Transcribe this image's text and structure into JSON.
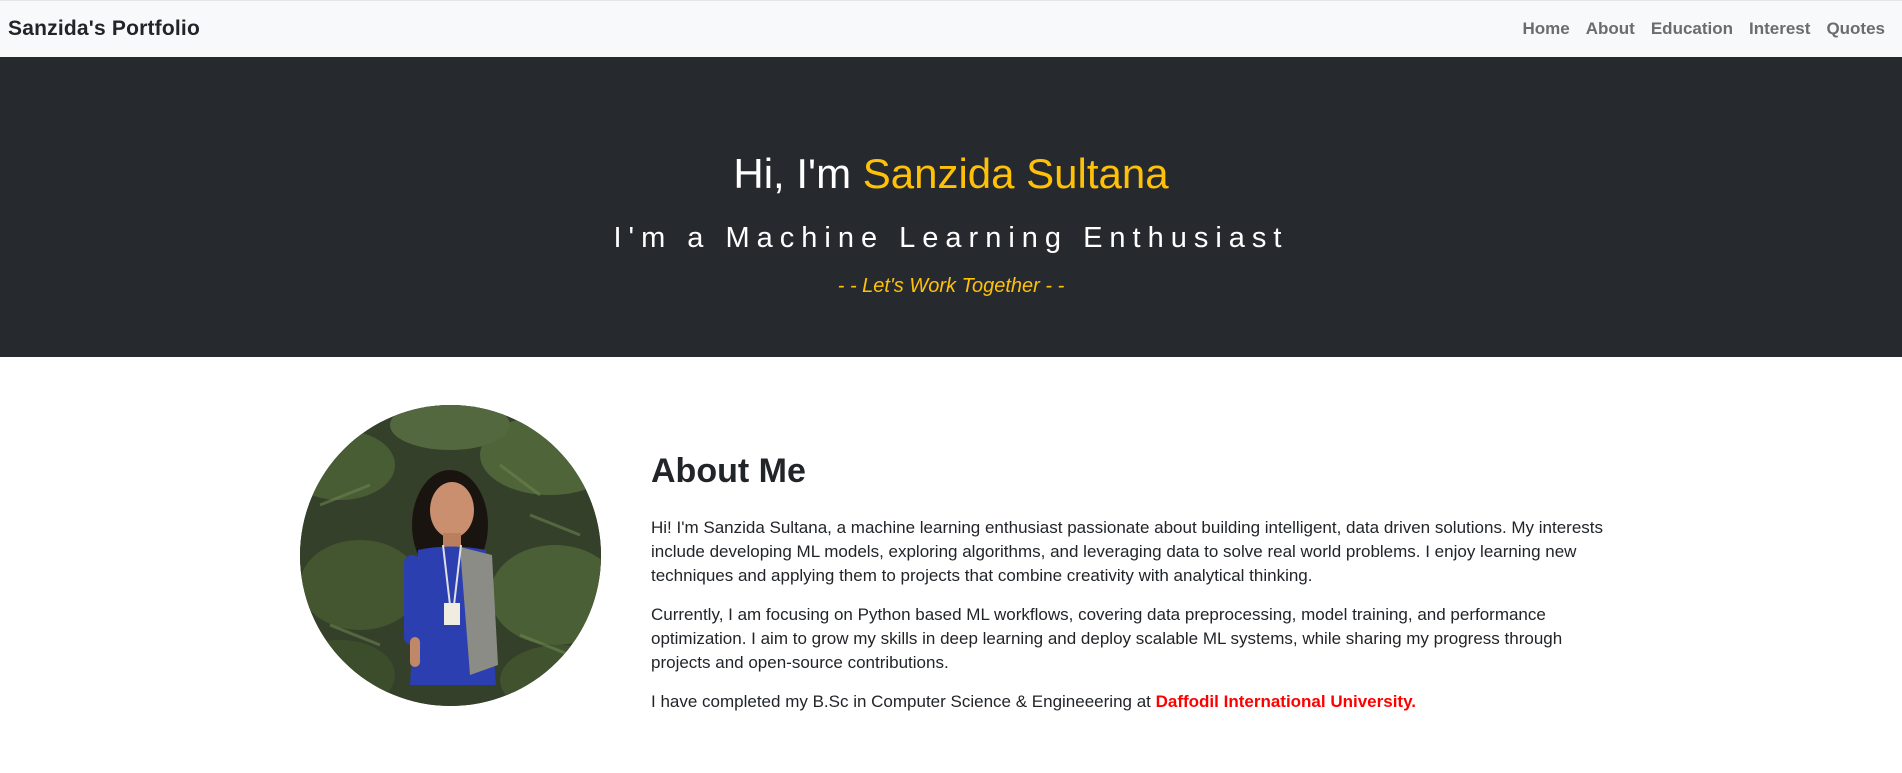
{
  "navbar": {
    "brand": "Sanzida's Portfolio",
    "links": [
      {
        "label": "Home"
      },
      {
        "label": "About"
      },
      {
        "label": "Education"
      },
      {
        "label": "Interest"
      },
      {
        "label": "Quotes"
      }
    ]
  },
  "hero": {
    "greeting": "Hi, I'm ",
    "name": "Sanzida Sultana",
    "subtitle": "I'm a Machine Learning Enthusiast",
    "cta": "- - Let's Work Together - -"
  },
  "about": {
    "heading": "About Me",
    "paragraph1": "Hi! I'm Sanzida Sultana, a machine learning enthusiast passionate about building intelligent, data driven solutions. My interests include developing ML models, exploring algorithms, and leveraging data to solve real world problems. I enjoy learning new techniques and applying them to projects that combine creativity with analytical thinking.",
    "paragraph2": "Currently, I am focusing on Python based ML workflows, covering data preprocessing, model training, and performance optimization. I aim to grow my skills in deep learning and deploy scalable ML systems, while sharing my progress through projects and open-source contributions.",
    "paragraph3_prefix": "I have completed my B.Sc in Computer Science & Engineeering at ",
    "university": "Daffodil International University."
  },
  "colors": {
    "accent": "#ffc107",
    "hero_bg": "#262a2f",
    "navbar_bg": "#f8f9fa",
    "university_link": "#ff0000"
  }
}
